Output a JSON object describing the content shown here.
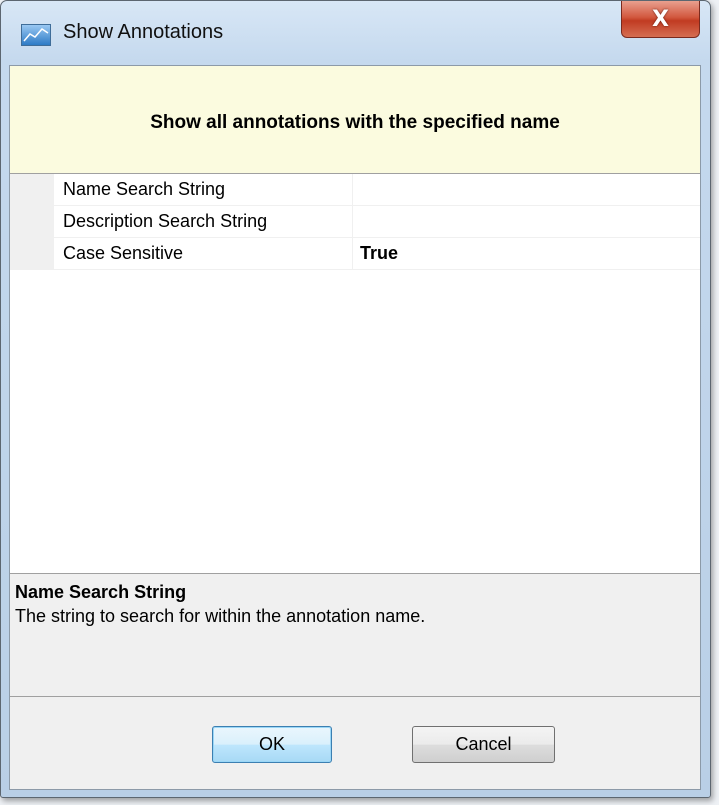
{
  "window": {
    "title": "Show Annotations",
    "close_label": "X"
  },
  "header": {
    "text": "Show all annotations with the specified name",
    "background": "#fbfbdf"
  },
  "properties": [
    {
      "name": "Name Search String",
      "value": ""
    },
    {
      "name": "Description Search String",
      "value": ""
    },
    {
      "name": "Case Sensitive",
      "value": "True"
    }
  ],
  "help": {
    "title": "Name Search String",
    "description": "The string to search for within the annotation name."
  },
  "buttons": {
    "ok_label": "OK",
    "cancel_label": "Cancel"
  },
  "colors": {
    "close_button": "#c13b22",
    "ok_button_border": "#3c7fb1"
  }
}
